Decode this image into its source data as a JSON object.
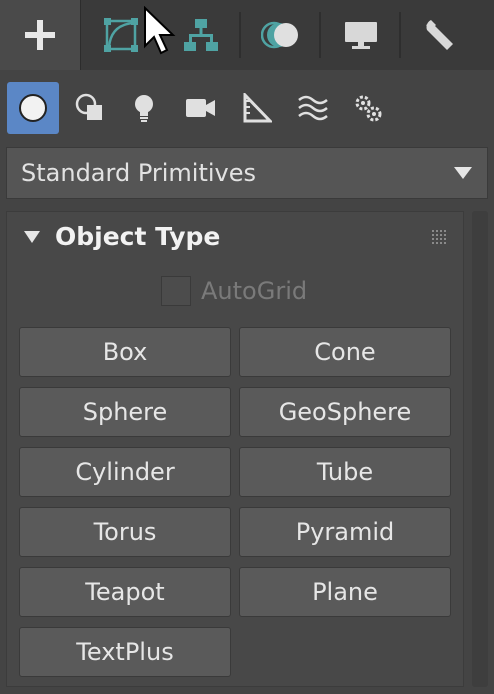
{
  "top_tabs": [
    {
      "name": "create",
      "icon": "plus-icon"
    },
    {
      "name": "modify",
      "icon": "modify-icon"
    },
    {
      "name": "hierarchy",
      "icon": "hierarchy-icon"
    },
    {
      "name": "motion",
      "icon": "motion-icon"
    },
    {
      "name": "display",
      "icon": "display-icon"
    },
    {
      "name": "utilities",
      "icon": "wrench-icon"
    }
  ],
  "categories": [
    {
      "name": "geometry",
      "icon": "sphere-icon",
      "active": true
    },
    {
      "name": "shapes",
      "icon": "shapes-icon"
    },
    {
      "name": "lights",
      "icon": "light-bulb-icon"
    },
    {
      "name": "cameras",
      "icon": "camera-icon"
    },
    {
      "name": "helpers",
      "icon": "helper-ruler-icon"
    },
    {
      "name": "space-warps",
      "icon": "waves-icon"
    },
    {
      "name": "systems",
      "icon": "gears-icon"
    }
  ],
  "dropdown": {
    "value": "Standard Primitives"
  },
  "rollout": {
    "title": "Object Type",
    "autogrid_label": "AutoGrid",
    "buttons": [
      "Box",
      "Cone",
      "Sphere",
      "GeoSphere",
      "Cylinder",
      "Tube",
      "Torus",
      "Pyramid",
      "Teapot",
      "Plane",
      "TextPlus"
    ]
  },
  "colors": {
    "active_blue": "#5b87c6",
    "teal_icon": "#4fa3a3"
  }
}
